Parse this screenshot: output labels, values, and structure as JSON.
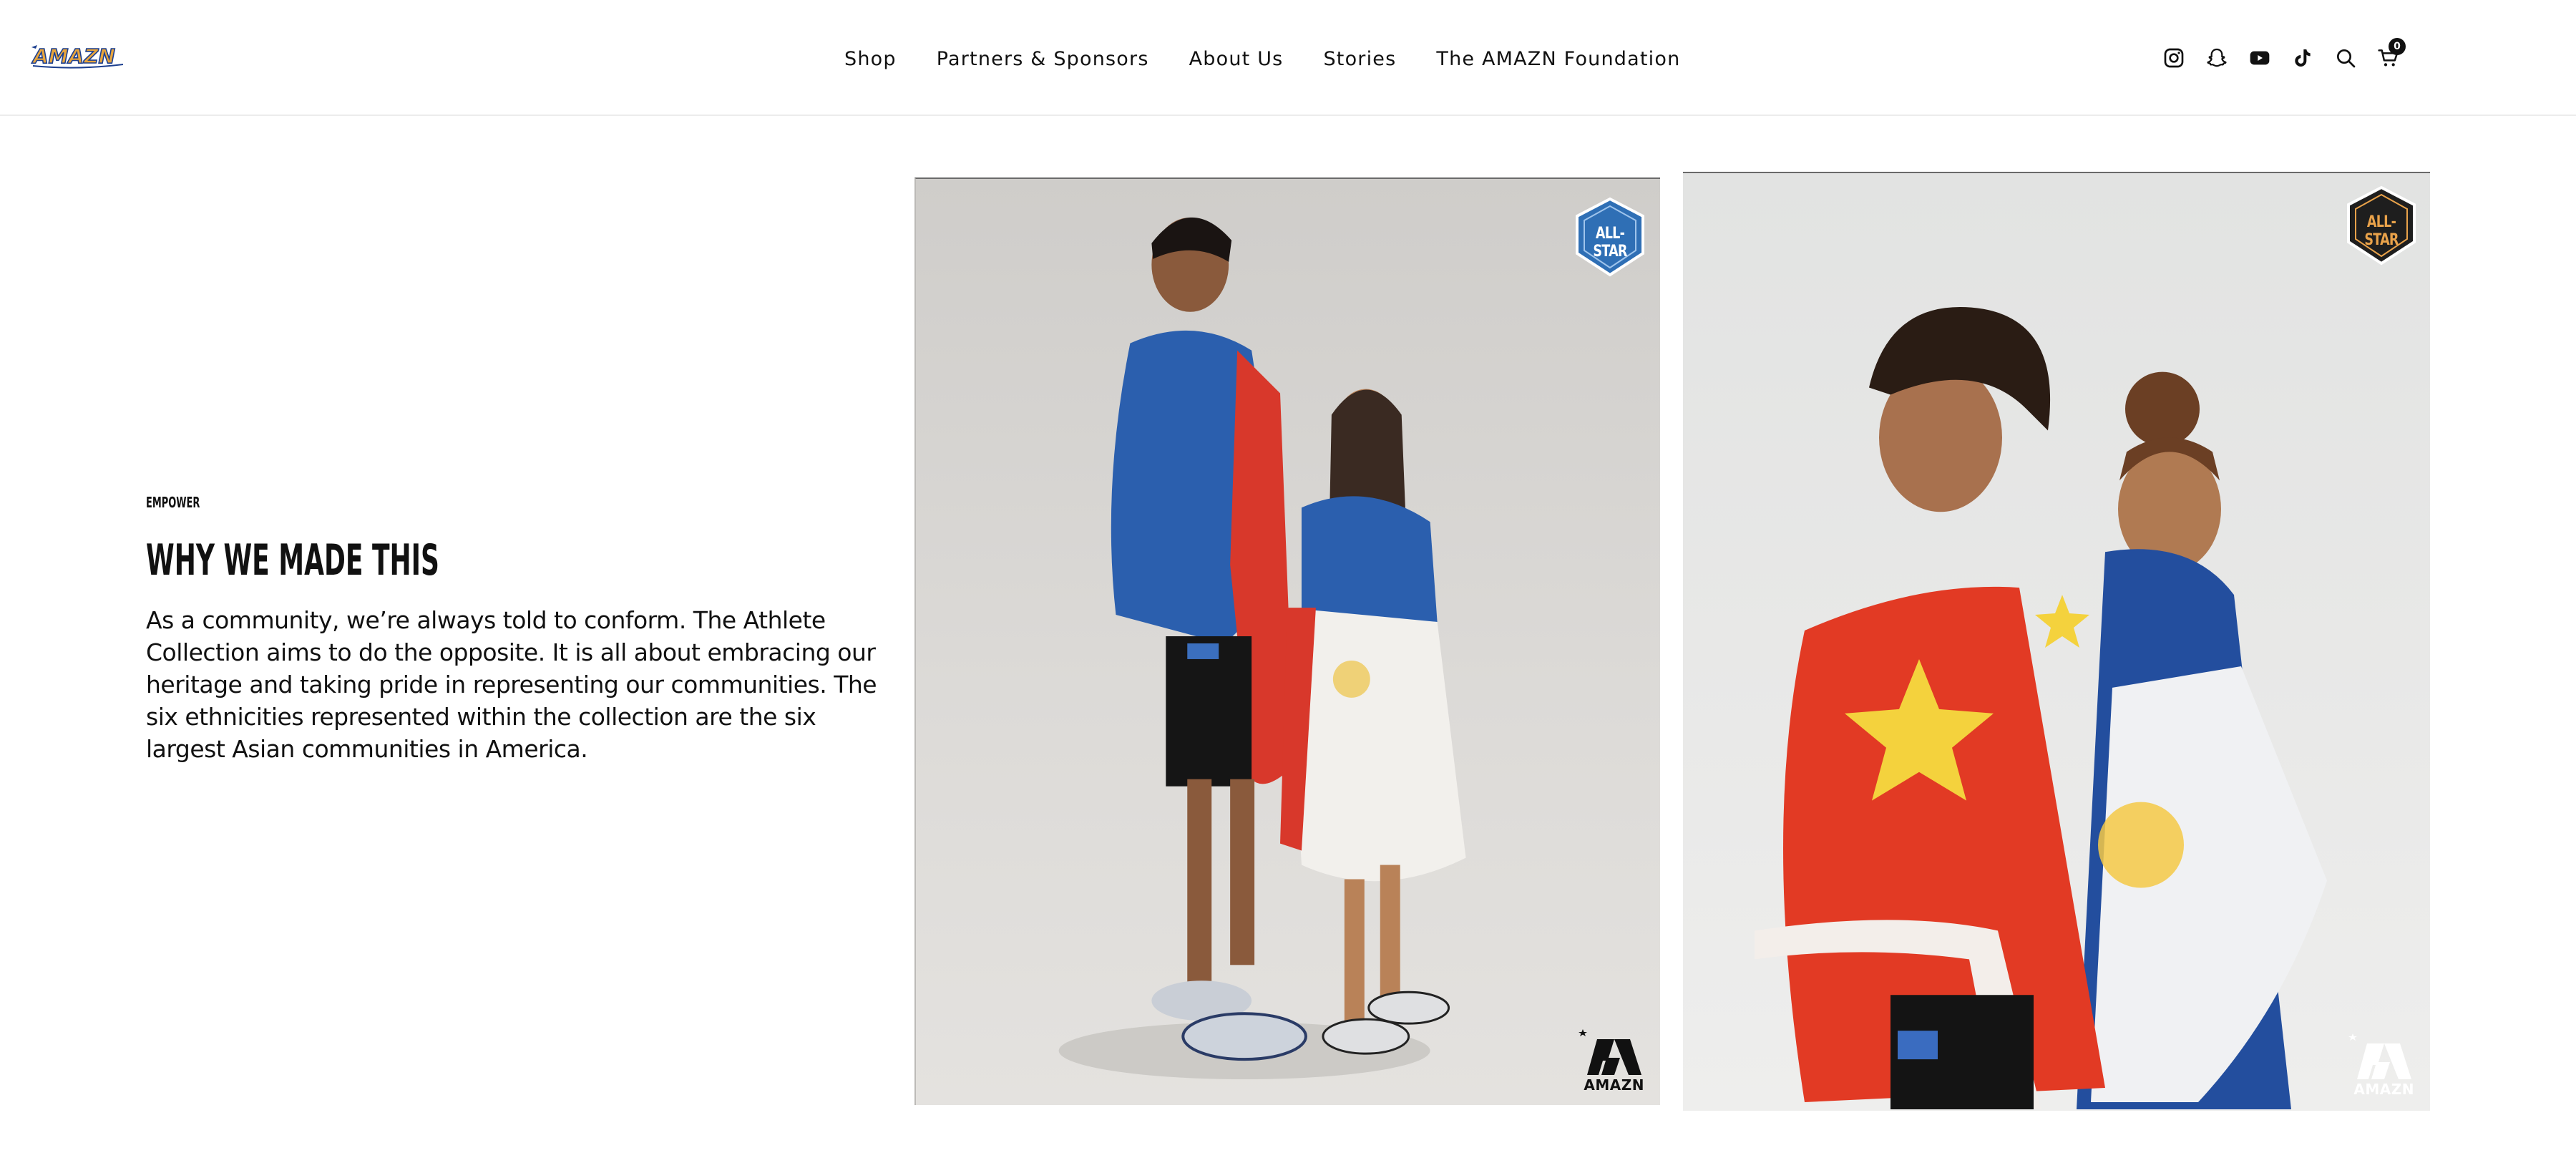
{
  "header": {
    "logo_text": "AMAZN",
    "nav": [
      {
        "label": "Shop"
      },
      {
        "label": "Partners & Sponsors"
      },
      {
        "label": "About Us"
      },
      {
        "label": "Stories"
      },
      {
        "label": "The AMAZN Foundation"
      }
    ],
    "icons": [
      "instagram-icon",
      "snapchat-icon",
      "youtube-icon",
      "tiktok-icon",
      "search-icon",
      "cart-icon"
    ],
    "cart_count": "0"
  },
  "section": {
    "eyebrow": "EMPOWER",
    "heading": "WHY WE MADE THIS",
    "body": "As a community, we’re always told to conform. The Athlete Collection aims to do the opposite. It is all about embracing our heritage and taking pride in representing our communities. The six ethnicities represented within the collection are the six largest Asian communities in America."
  },
  "photos": [
    {
      "badge_text": "ALL-STAR",
      "brand_text": "AMAZN",
      "colors": {
        "badge": "#2f6fb5",
        "flag_blue": "#2b5fae",
        "flag_red": "#d8382b"
      }
    },
    {
      "badge_text": "ALL-STAR",
      "brand_text": "AMAZN",
      "colors": {
        "badge": "#1e1e1e",
        "flag_red": "#e23a24",
        "flag_star": "#f4d23d"
      }
    }
  ]
}
